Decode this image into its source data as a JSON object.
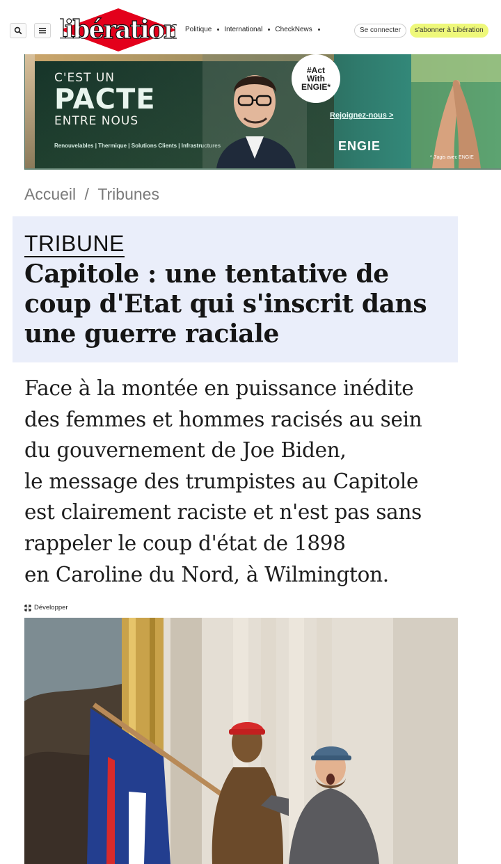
{
  "header": {
    "search_icon": "search-icon",
    "menu_icon": "hamburger-menu-icon",
    "logo_text": "libération",
    "nav": [
      "Politique",
      "International",
      "CheckNews"
    ],
    "login_label": "Se connecter",
    "subscribe_label": "s'abonner à Libération",
    "subscribe_color": "#eef87a",
    "brand_red": "#e3001b"
  },
  "ad": {
    "headline_1": "C'EST UN",
    "headline_2": "PACTE",
    "headline_3": "ENTRE NOUS",
    "categories": "Renouvelables | Thermique | Solutions Clients | Infrastructures",
    "hashtag_1": "#Act",
    "hashtag_2": "With",
    "hashtag_3": "ENGIE*",
    "cta": "Rejoignez-nous >",
    "brand": "ENGIE",
    "note": "* J'agis avec ENGIE"
  },
  "breadcrumb": {
    "home": "Accueil",
    "separator": "/",
    "section": "Tribunes"
  },
  "article": {
    "rubric": "TRIBUNE",
    "title": "Capitole : une tentative de coup d'Etat qui s'inscrit dans une guerre raciale",
    "lead_lines": [
      "Face à la montée en puissance inédite",
      "des femmes et hommes racisés au sein",
      "du gouvernement de Joe Biden,",
      "le message des trumpistes au Capitole",
      "est clairement raciste et n'est pas sans",
      "rappeler le coup d'état de 1898",
      "en Caroline du Nord, à Wilmington."
    ],
    "expand_label": "Développer",
    "title_bg": "#eaeefa"
  }
}
